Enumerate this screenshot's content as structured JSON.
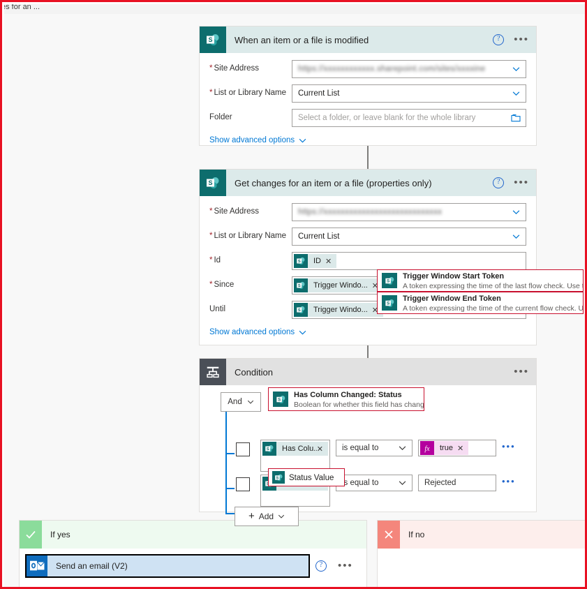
{
  "window": {
    "clipped_title": "es for an ...",
    "frame_color": "#e81123"
  },
  "trigger_card": {
    "icon": "sharepoint-icon",
    "title": "When an item or a file is modified",
    "help_icon": "?",
    "more_icon": "•••",
    "fields": [
      {
        "label": "Site Address",
        "required": true,
        "value": "https://xxxxxxxxxxxx.sharepoint.com/sites/xxxxine",
        "value_tail": "ine",
        "blurred": true,
        "control": "dropdown"
      },
      {
        "label": "List or Library Name",
        "required": true,
        "value": "Current List",
        "control": "dropdown"
      },
      {
        "label": "Folder",
        "required": false,
        "placeholder": "Select a folder, or leave blank for the whole library",
        "control": "folder-picker"
      }
    ],
    "advanced_link": "Show advanced options"
  },
  "get_changes_card": {
    "icon": "sharepoint-icon",
    "title": "Get changes for an item or a file (properties only)",
    "help_icon": "?",
    "more_icon": "•••",
    "fields": [
      {
        "label": "Site Address",
        "required": true,
        "value": "https://xxxxxxxxxxxxxxxxxxxxxxxxxxxx",
        "blurred": true,
        "control": "dropdown"
      },
      {
        "label": "List or Library Name",
        "required": true,
        "value": "Current List",
        "control": "dropdown"
      },
      {
        "label": "Id",
        "required": true,
        "token": "ID",
        "control": "token-field"
      },
      {
        "label": "Since",
        "required": true,
        "token": "Trigger Windo...",
        "control": "token-field"
      },
      {
        "label": "Until",
        "required": false,
        "token": "Trigger Windo...",
        "control": "token-field"
      }
    ],
    "advanced_link": "Show advanced options",
    "callouts": [
      {
        "title": "Trigger Window Start Token",
        "description": "A token expressing the time of the last flow check. Use this if..",
        "icon": "sharepoint-icon"
      },
      {
        "title": "Trigger Window End Token",
        "description": "A token expressing the time of the current flow check. Use t...",
        "icon": "sharepoint-icon"
      }
    ]
  },
  "condition_card": {
    "icon": "condition-icon",
    "title": "Condition",
    "more_icon": "•••",
    "operator_group": "And",
    "rows": [
      {
        "field_token": "Has Colu...",
        "operator": "is equal to",
        "value_token": "true",
        "value_is_expression": true,
        "more_icon": "•••"
      },
      {
        "field_token": "Status Va...",
        "operator": "is equal to",
        "value": "Rejected",
        "value_is_expression": false,
        "more_icon": "•••"
      }
    ],
    "add_button": "Add",
    "callouts": [
      {
        "title": "Has Column Changed: Status",
        "description": "Boolean for whether this field has changed",
        "icon": "sharepoint-icon"
      },
      {
        "title": "Status Value",
        "description": "",
        "icon": "sharepoint-icon"
      }
    ]
  },
  "branches": {
    "yes": {
      "label": "If yes",
      "icon": "checkmark-icon",
      "action": {
        "title": "Send an email (V2)",
        "icon": "outlook-icon",
        "help_icon": "?",
        "more_icon": "•••"
      }
    },
    "no": {
      "label": "If no",
      "icon": "cross-icon"
    }
  }
}
